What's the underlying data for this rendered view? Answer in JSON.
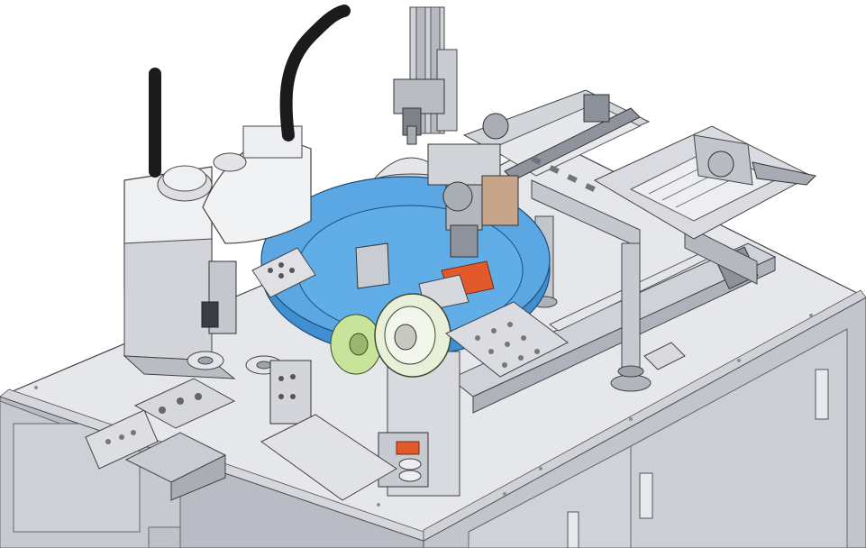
{
  "scene": {
    "description_shown": false,
    "colors": {
      "background": "#ffffff",
      "cabinet": "#c9ccd3",
      "cabinet_dark": "#9ea2ab",
      "deck": "#e3e4e8",
      "turntable": "#5aa7e3",
      "turntable_dark": "#3f8fd1",
      "robot_white": "#eef0f2",
      "cable": "#1b1b1b",
      "tape_green": "#c8e39a",
      "tape_roll": "#e9efd9",
      "highlight_red": "#e25a2b",
      "steel": "#b7bbc2",
      "steel_dark": "#6f737b"
    },
    "components": [
      "machine-cabinet",
      "work-deck",
      "scara-robot",
      "robot-cable",
      "rotary-turntable",
      "vertical-column",
      "linear-gantry",
      "dome-cover",
      "tape-reel",
      "feeder-tray",
      "side-conveyor",
      "support-pillar",
      "vision-camera"
    ]
  }
}
